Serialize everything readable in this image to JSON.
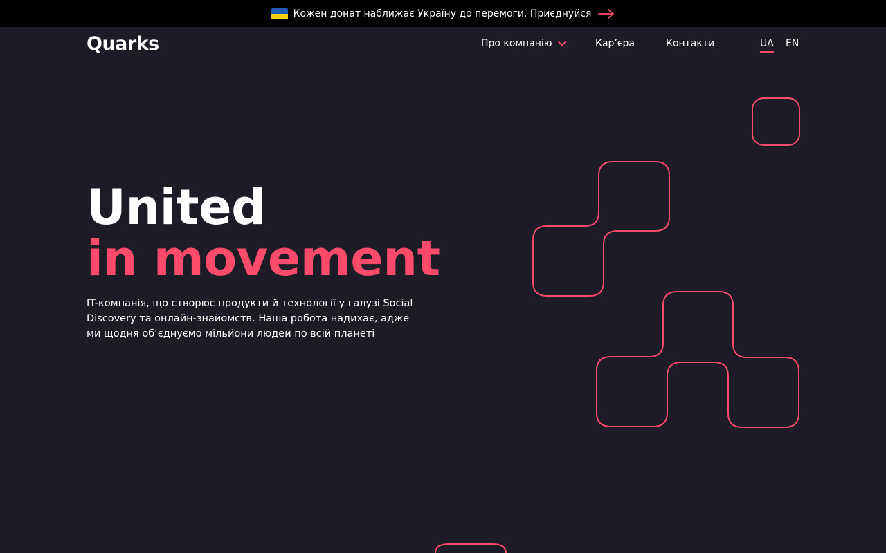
{
  "banner": {
    "text": "Кожен донат наближає Україну до перемоги. Приєднуйся",
    "flag_colors": [
      "#1d5fb8",
      "#f7d117"
    ],
    "arrow_icon": "arrow-right-icon"
  },
  "header": {
    "logo": "Quarks",
    "nav": {
      "about": "Про компанію",
      "career": "Кар’єра",
      "contacts": "Контакти"
    },
    "languages": [
      "UA",
      "EN"
    ],
    "active_language": "UA"
  },
  "hero": {
    "title_line1": "United",
    "title_line2": "in movement",
    "description": "IT-компанія, що створює продукти й технології у галузі Social Discovery та онлайн-знайомств. Наша робота надихає, адже ми щодня об’єднуємо мільйони людей по всій планеті"
  },
  "colors": {
    "background": "#1d1b25",
    "accent": "#ff4b6b",
    "banner": "#000000"
  }
}
